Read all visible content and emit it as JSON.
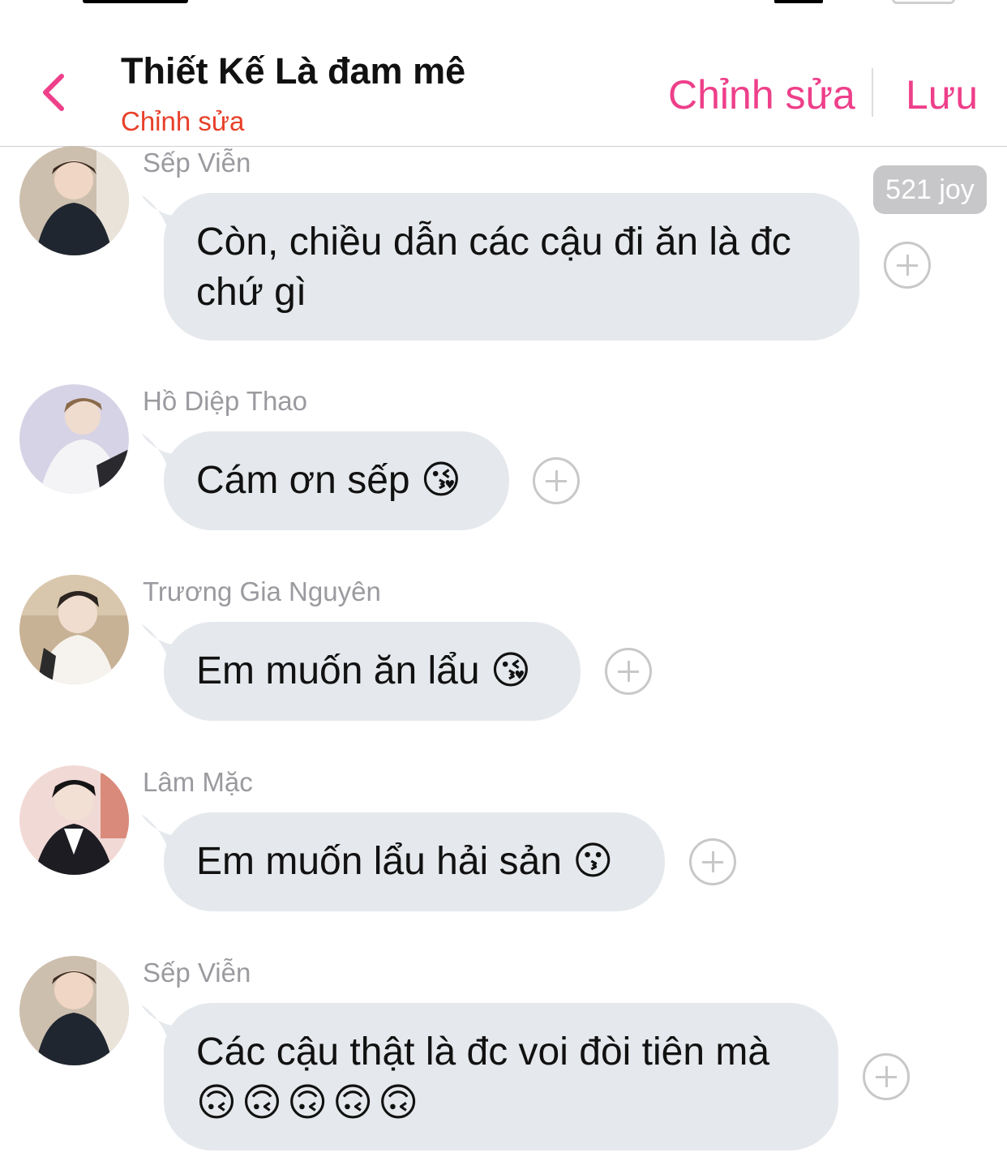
{
  "header": {
    "title": "Thiết Kế Là đam mê",
    "subtitle": "Chỉnh sửa",
    "edit_label": "Chỉnh sửa",
    "save_label": "Lưu",
    "accent_color": "#ee3f8a",
    "subtitle_color": "#e8402a"
  },
  "badge": {
    "label": "521 joy"
  },
  "messages": [
    {
      "sender": "Sếp Viễn",
      "line1": "Còn, chiều dẫn các cậu đi ăn là đc",
      "line2": "chứ gì"
    },
    {
      "sender": "Hồ Diệp Thao",
      "line1": "Cám ơn sếp 😘"
    },
    {
      "sender": "Trương Gia Nguyên",
      "line1": "Em muốn ăn lẩu 😘"
    },
    {
      "sender": "Lâm Mặc",
      "line1": "Em muốn lẩu hải sản 😗"
    },
    {
      "sender": "Sếp Viễn",
      "line1": "Các cậu thật là đc voi đòi tiên mà",
      "line2": "🙃🙃🙃🙃🙃"
    }
  ],
  "icons": {
    "back": "chevron-left-icon",
    "add_reaction": "plus-circle-icon"
  }
}
